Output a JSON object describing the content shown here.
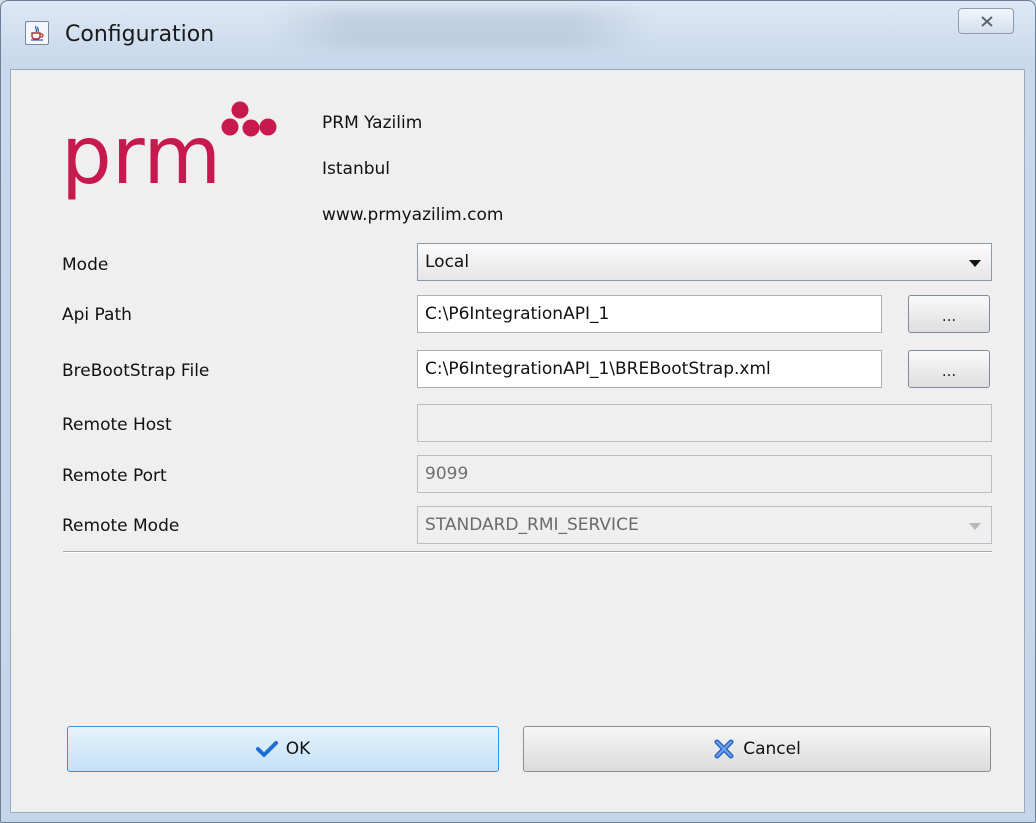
{
  "window": {
    "title": "Configuration",
    "icon": "java-cup-icon",
    "close_icon": "close-icon"
  },
  "company": {
    "logo_text": "prm",
    "brand_color": "#c8194e",
    "name": "PRM Yazilim",
    "city": "Istanbul",
    "website": "www.prmyazilim.com"
  },
  "form": {
    "mode": {
      "label": "Mode",
      "value": "Local"
    },
    "api_path": {
      "label": "Api Path",
      "value": "C:\\P6IntegrationAPI_1",
      "browse_label": "..."
    },
    "bootstrap_file": {
      "label": "BreBootStrap File",
      "value": "C:\\P6IntegrationAPI_1\\BREBootStrap.xml",
      "browse_label": "..."
    },
    "remote_host": {
      "label": "Remote Host",
      "value": ""
    },
    "remote_port": {
      "label": "Remote Port",
      "value": "9099"
    },
    "remote_mode": {
      "label": "Remote Mode",
      "value": "STANDARD_RMI_SERVICE"
    }
  },
  "buttons": {
    "ok": {
      "label": "OK",
      "icon": "checkmark-icon"
    },
    "cancel": {
      "label": "Cancel",
      "icon": "x-icon"
    }
  }
}
